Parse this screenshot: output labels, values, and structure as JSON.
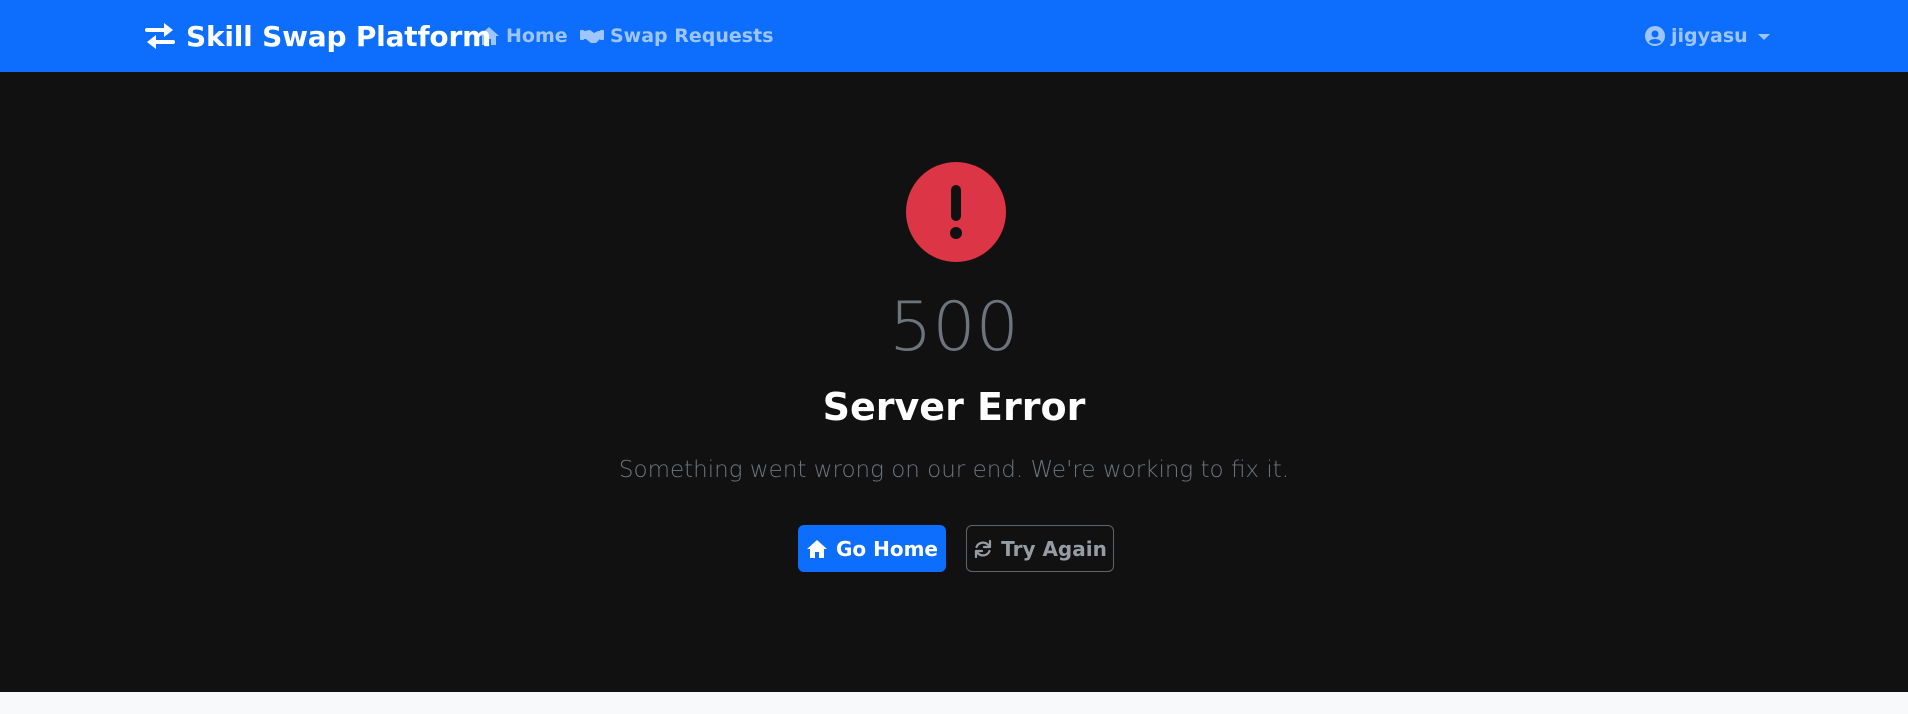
{
  "navbar": {
    "brand": "Skill Swap Platform",
    "links": [
      {
        "label": "Home",
        "icon": "home-icon"
      },
      {
        "label": "Swap Requests",
        "icon": "handshake-icon"
      }
    ],
    "user": {
      "label": "jigyasu",
      "icon": "user-circle-icon"
    }
  },
  "error": {
    "code": "500",
    "title": "Server Error",
    "message": "Something went wrong on our end. We're working to fix it.",
    "icon": "exclamation-circle-icon",
    "buttons": {
      "home": {
        "label": "Go Home",
        "icon": "home-icon"
      },
      "retry": {
        "label": "Try Again",
        "icon": "refresh-icon"
      }
    }
  },
  "colors": {
    "primary": "#0d6efd",
    "danger": "#dc3545",
    "background": "#111112",
    "muted": "#6c757d"
  }
}
